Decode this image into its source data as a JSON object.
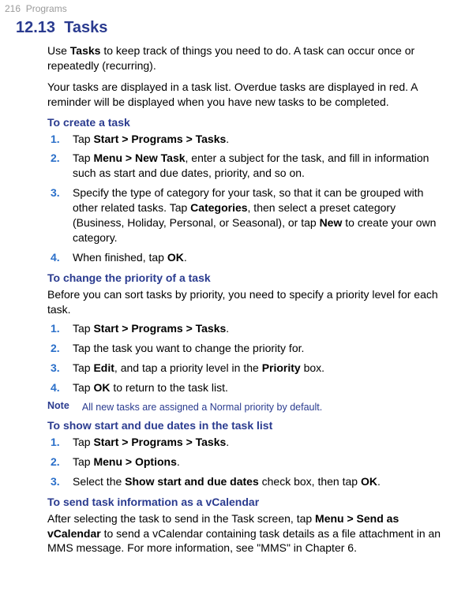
{
  "header": {
    "page_number": "216",
    "chapter": "Programs"
  },
  "section": {
    "number": "12.13",
    "title": "Tasks"
  },
  "intro": {
    "p1_a": "Use ",
    "p1_b": "Tasks",
    "p1_c": " to keep track of things you need to do. A task can occur once or repeatedly (recurring).",
    "p2": "Your tasks are displayed in a task list. Overdue tasks are displayed in red. A reminder will be displayed when you have new tasks to be completed."
  },
  "create": {
    "heading": "To create a task",
    "steps": [
      {
        "a": "Tap ",
        "b": "Start > Programs > Tasks",
        "c": "."
      },
      {
        "a": "Tap ",
        "b": "Menu > New Task",
        "c": ", enter a subject for the task, and fill in information such as start and due dates, priority, and so on."
      },
      {
        "a": "Specify the type of category for your task, so that it can be grouped with other related tasks. Tap ",
        "b": "Categories",
        "c": ", then select a preset category (Business, Holiday, Personal, or Seasonal), or tap ",
        "d": "New",
        "e": " to create your own category."
      },
      {
        "a": "When finished, tap ",
        "b": "OK",
        "c": "."
      }
    ]
  },
  "priority": {
    "heading": "To change the priority of a task",
    "intro": "Before you can sort tasks by priority, you need to specify a priority level for each task.",
    "steps": [
      {
        "a": "Tap ",
        "b": "Start > Programs > Tasks",
        "c": "."
      },
      {
        "a": "Tap the task you want to change the priority for."
      },
      {
        "a": "Tap ",
        "b": "Edit",
        "c": ", and tap a priority level in the ",
        "d": "Priority",
        "e": " box."
      },
      {
        "a": "Tap ",
        "b": "OK",
        "c": " to return to the task list."
      }
    ],
    "note_label": "Note",
    "note_text": "All new tasks are assigned a Normal priority by default."
  },
  "showdates": {
    "heading": "To show start and due dates in the task list",
    "steps": [
      {
        "a": "Tap ",
        "b": "Start > Programs > Tasks",
        "c": "."
      },
      {
        "a": "Tap ",
        "b": "Menu > Options",
        "c": "."
      },
      {
        "a": "Select the ",
        "b": "Show start and due dates",
        "c": " check box, then tap ",
        "d": "OK",
        "e": "."
      }
    ]
  },
  "vcal": {
    "heading": "To send task information as a vCalendar",
    "p_a": "After selecting the task to send in the Task screen, tap ",
    "p_b": "Menu > Send as vCalendar",
    "p_c": " to send a vCalendar containing task details as a file attachment in an MMS message. For more information, see \"MMS\" in Chapter 6."
  }
}
